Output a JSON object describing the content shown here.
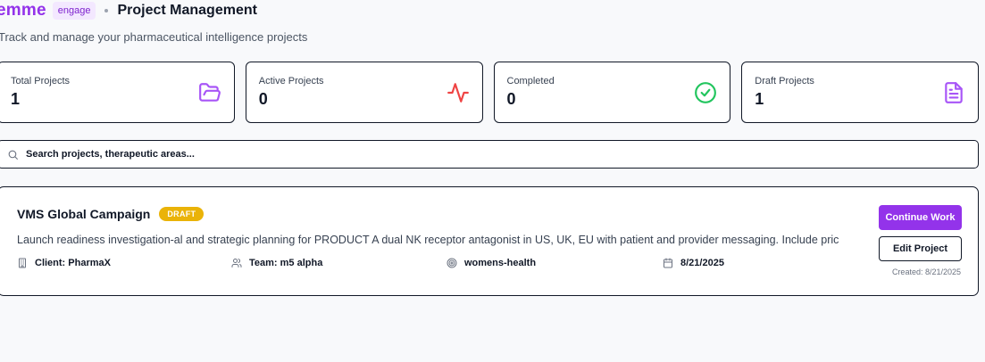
{
  "header": {
    "brand": "emme",
    "badge": "engage",
    "title": "Project Management",
    "subtitle": "Track and manage your pharmaceutical intelligence projects"
  },
  "stats": [
    {
      "label": "Total Projects",
      "value": "1",
      "icon": "folder-open-icon",
      "color": "#a855f7"
    },
    {
      "label": "Active Projects",
      "value": "0",
      "icon": "activity-icon",
      "color": "#ef4444"
    },
    {
      "label": "Completed",
      "value": "0",
      "icon": "check-circle-icon",
      "color": "#22c55e"
    },
    {
      "label": "Draft Projects",
      "value": "1",
      "icon": "document-icon",
      "color": "#a855f7"
    }
  ],
  "search": {
    "placeholder": "Search projects, therapeutic areas..."
  },
  "project": {
    "title": "VMS Global Campaign",
    "status": "DRAFT",
    "description": "Launch readiness investigation-al and strategic planning for PRODUCT A dual NK receptor antagonist in US, UK, EU with patient and provider messaging. Include pric",
    "client": "Client: PharmaX",
    "team": "Team: m5 alpha",
    "area": "womens-health",
    "date": "8/21/2025",
    "continue_label": "Continue Work",
    "edit_label": "Edit Project",
    "created": "Created: 8/21/2025"
  },
  "colors": {
    "accent": "#9333ea",
    "draft": "#eab308"
  }
}
